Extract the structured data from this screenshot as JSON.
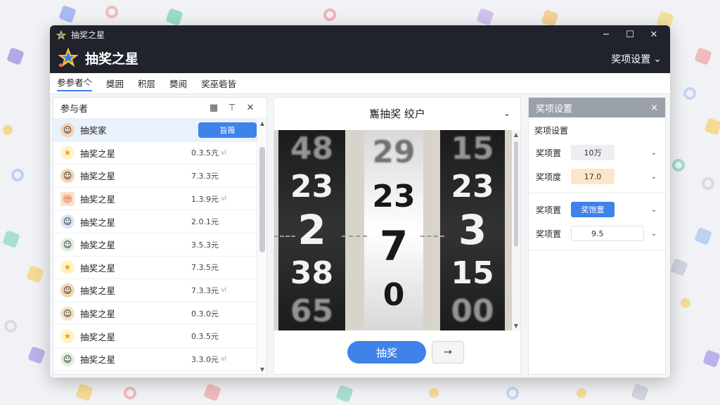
{
  "window": {
    "title_small": "抽奖之星",
    "title_big": "抽奖之星",
    "menu_label": "奖项设置",
    "controls": {
      "minimize": "─",
      "maximize": "☐",
      "close": "✕"
    }
  },
  "tabs": [
    {
      "label": "参参者亽"
    },
    {
      "label": "獎囲"
    },
    {
      "label": "积层"
    },
    {
      "label": "奦阅"
    },
    {
      "label": "奖巫砦皆"
    }
  ],
  "participants": {
    "header": "参与者",
    "rows": [
      {
        "name": "抽奖家",
        "pill": "旨薇",
        "avatar": "face"
      },
      {
        "name": "抽奖之星",
        "value": "0.3.5亢",
        "extra": "ⅵ",
        "avatar": "star"
      },
      {
        "name": "抽奖之星",
        "value": "7.3.3元",
        "extra": "",
        "avatar": "face"
      },
      {
        "name": "抽奖之星",
        "value": "1.3.9元",
        "extra": "ⅵ",
        "avatar": "gift"
      },
      {
        "name": "抽奖之星",
        "value": "2.0.1元",
        "extra": "",
        "avatar": "face"
      },
      {
        "name": "抽奖之星",
        "value": "3.5.3元",
        "extra": "",
        "avatar": "face"
      },
      {
        "name": "抽奖之星",
        "value": "7.3.5元",
        "extra": "",
        "avatar": "star"
      },
      {
        "name": "抽奖之星",
        "value": "7.3.3元",
        "extra": "ⅵ",
        "avatar": "face"
      },
      {
        "name": "抽奖之星",
        "value": "0.3.0元",
        "extra": "",
        "avatar": "face"
      },
      {
        "name": "抽奖之星",
        "value": "0.3.5元",
        "extra": "",
        "avatar": "star"
      },
      {
        "name": "抽奖之星",
        "value": "3.3.0元",
        "extra": "ⅵ",
        "avatar": "face"
      }
    ]
  },
  "center": {
    "title": "雟抽奖  绞户",
    "reels": [
      {
        "top": "48",
        "upper": "23",
        "mid": "2",
        "lower": "38",
        "bottom": "65"
      },
      {
        "top": "29",
        "upper": "23",
        "mid": "7",
        "lower": "0",
        "bottom": ""
      },
      {
        "top": "15",
        "upper": "23",
        "mid": "3",
        "lower": "15",
        "bottom": "00"
      }
    ],
    "draw_button": "抽奖",
    "next_button": "→"
  },
  "settings": {
    "header": "奖项设置",
    "close": "×",
    "subheader": "奖项设置",
    "rows": [
      {
        "label": "奖项置",
        "value": "10万"
      },
      {
        "label": "奖项度",
        "value": "17.0"
      },
      {
        "label": "奖项置",
        "value": "奖饱置"
      },
      {
        "label": "奖项置",
        "value": "9.5"
      }
    ]
  },
  "colors": {
    "titlebar": "#20222c",
    "accent": "#3f82ea",
    "peach": "#fde5cc"
  }
}
